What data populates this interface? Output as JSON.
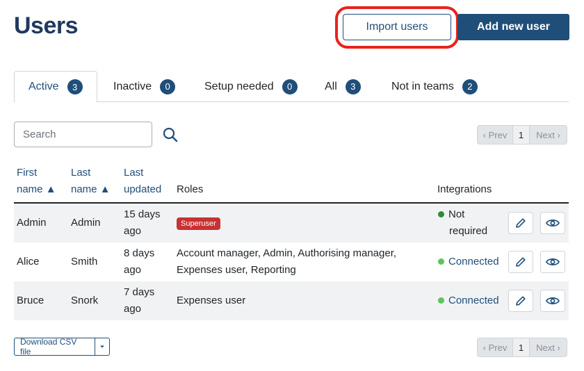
{
  "page": {
    "title": "Users"
  },
  "header": {
    "import_label": "Import users",
    "add_label": "Add new user"
  },
  "tabs": [
    {
      "label": "Active",
      "count": "3",
      "active": true
    },
    {
      "label": "Inactive",
      "count": "0"
    },
    {
      "label": "Setup needed",
      "count": "0"
    },
    {
      "label": "All",
      "count": "3"
    },
    {
      "label": "Not in teams",
      "count": "2"
    }
  ],
  "search": {
    "placeholder": "Search",
    "icon": "search-icon"
  },
  "pagination": {
    "prev_label": "‹ Prev",
    "page": "1",
    "next_label": "Next ›"
  },
  "table": {
    "columns": {
      "first_name_l1": "First",
      "first_name_l2": "name ▲",
      "last_name_l1": "Last",
      "last_name_l2": "name ▲",
      "last_updated_l1": "Last",
      "last_updated_l2": "updated",
      "roles": "Roles",
      "integrations": "Integrations"
    },
    "rows": [
      {
        "first": "Admin",
        "last": "Admin",
        "updated_l1": "15 days",
        "updated_l2": "ago",
        "roles_badge": "Superuser",
        "roles_l1": "",
        "roles_l2": "",
        "integration_l1": "Not",
        "integration_l2": "required",
        "integration_color": "#2e8b3a"
      },
      {
        "first": "Alice",
        "last": "Smith",
        "updated_l1": "8 days",
        "updated_l2": "ago",
        "roles_l1": "Account manager, Admin, Authorising manager,",
        "roles_l2": "Expenses user, Reporting",
        "integration": "Connected",
        "integration_color": "#5cc45c"
      },
      {
        "first": "Bruce",
        "last": "Snork",
        "updated_l1": "7 days",
        "updated_l2": "ago",
        "roles_l1": "Expenses user",
        "integration": "Connected",
        "integration_color": "#5cc45c"
      }
    ]
  },
  "footer": {
    "csv_label": "Download CSV file"
  },
  "colors": {
    "brand": "#1f4e79",
    "highlight": "#e8231b",
    "superuser": "#c73232"
  },
  "icons": {
    "edit": "pencil-icon",
    "view": "eye-icon",
    "caret": "caret-down-icon"
  }
}
